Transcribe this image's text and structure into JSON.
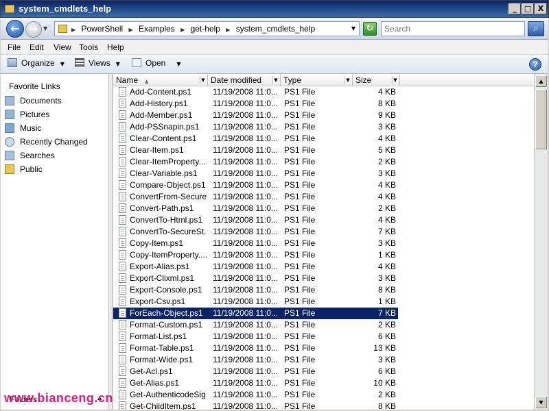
{
  "window": {
    "title": "system_cmdlets_help",
    "min_label": "_",
    "max_label": "□",
    "close_label": "X"
  },
  "address": {
    "path": [
      "PowerShell",
      "Examples",
      "get-help",
      "system_cmdlets_help"
    ],
    "back_glyph": "←",
    "fwd_glyph": "→",
    "refresh_glyph": "↻",
    "search_placeholder": "Search",
    "search_glyph": "⌕"
  },
  "menu": {
    "file": "File",
    "edit": "Edit",
    "view": "View",
    "tools": "Tools",
    "help": "Help"
  },
  "toolbar": {
    "organize": "Organize",
    "views": "Views",
    "open": "Open",
    "help_glyph": "?"
  },
  "nav": {
    "heading": "Favorite Links",
    "items": [
      "Documents",
      "Pictures",
      "Music",
      "Recently Changed",
      "Searches",
      "Public"
    ],
    "folders": "Folders"
  },
  "watermark": "www.bianceng.cn",
  "columns": {
    "name": "Name",
    "date": "Date modified",
    "type": "Type",
    "size": "Size"
  },
  "files": [
    {
      "name": "Add-Content.ps1",
      "date": "11/19/2008 11:0...",
      "type": "PS1 File",
      "size": "4 KB"
    },
    {
      "name": "Add-History.ps1",
      "date": "11/19/2008 11:0...",
      "type": "PS1 File",
      "size": "8 KB"
    },
    {
      "name": "Add-Member.ps1",
      "date": "11/19/2008 11:0...",
      "type": "PS1 File",
      "size": "9 KB"
    },
    {
      "name": "Add-PSSnapin.ps1",
      "date": "11/19/2008 11:0...",
      "type": "PS1 File",
      "size": "3 KB"
    },
    {
      "name": "Clear-Content.ps1",
      "date": "11/19/2008 11:0...",
      "type": "PS1 File",
      "size": "4 KB"
    },
    {
      "name": "Clear-Item.ps1",
      "date": "11/19/2008 11:0...",
      "type": "PS1 File",
      "size": "5 KB"
    },
    {
      "name": "Clear-ItemProperty....",
      "date": "11/19/2008 11:0...",
      "type": "PS1 File",
      "size": "2 KB"
    },
    {
      "name": "Clear-Variable.ps1",
      "date": "11/19/2008 11:0...",
      "type": "PS1 File",
      "size": "3 KB"
    },
    {
      "name": "Compare-Object.ps1",
      "date": "11/19/2008 11:0...",
      "type": "PS1 File",
      "size": "4 KB"
    },
    {
      "name": "ConvertFrom-Secure...",
      "date": "11/19/2008 11:0...",
      "type": "PS1 File",
      "size": "4 KB"
    },
    {
      "name": "Convert-Path.ps1",
      "date": "11/19/2008 11:0...",
      "type": "PS1 File",
      "size": "2 KB"
    },
    {
      "name": "ConvertTo-Html.ps1",
      "date": "11/19/2008 11:0...",
      "type": "PS1 File",
      "size": "4 KB"
    },
    {
      "name": "ConvertTo-SecureSt...",
      "date": "11/19/2008 11:0...",
      "type": "PS1 File",
      "size": "7 KB"
    },
    {
      "name": "Copy-Item.ps1",
      "date": "11/19/2008 11:0...",
      "type": "PS1 File",
      "size": "3 KB"
    },
    {
      "name": "Copy-ItemProperty....",
      "date": "11/19/2008 11:0...",
      "type": "PS1 File",
      "size": "1 KB"
    },
    {
      "name": "Export-Alias.ps1",
      "date": "11/19/2008 11:0...",
      "type": "PS1 File",
      "size": "4 KB"
    },
    {
      "name": "Export-Clixml.ps1",
      "date": "11/19/2008 11:0...",
      "type": "PS1 File",
      "size": "3 KB"
    },
    {
      "name": "Export-Console.ps1",
      "date": "11/19/2008 11:0...",
      "type": "PS1 File",
      "size": "8 KB"
    },
    {
      "name": "Export-Csv.ps1",
      "date": "11/19/2008 11:0...",
      "type": "PS1 File",
      "size": "1 KB"
    },
    {
      "name": "ForEach-Object.ps1",
      "date": "11/19/2008 11:0...",
      "type": "PS1 File",
      "size": "7 KB",
      "selected": true
    },
    {
      "name": "Format-Custom.ps1",
      "date": "11/19/2008 11:0...",
      "type": "PS1 File",
      "size": "2 KB"
    },
    {
      "name": "Format-List.ps1",
      "date": "11/19/2008 11:0...",
      "type": "PS1 File",
      "size": "6 KB"
    },
    {
      "name": "Format-Table.ps1",
      "date": "11/19/2008 11:0...",
      "type": "PS1 File",
      "size": "13 KB"
    },
    {
      "name": "Format-Wide.ps1",
      "date": "11/19/2008 11:0...",
      "type": "PS1 File",
      "size": "3 KB"
    },
    {
      "name": "Get-Acl.ps1",
      "date": "11/19/2008 11:0...",
      "type": "PS1 File",
      "size": "6 KB"
    },
    {
      "name": "Get-Alias.ps1",
      "date": "11/19/2008 11:0...",
      "type": "PS1 File",
      "size": "10 KB"
    },
    {
      "name": "Get-AuthenticodeSig...",
      "date": "11/19/2008 11:0...",
      "type": "PS1 File",
      "size": "2 KB"
    },
    {
      "name": "Get-ChildItem.ps1",
      "date": "11/19/2008 11:0...",
      "type": "PS1 File",
      "size": "8 KB"
    }
  ]
}
